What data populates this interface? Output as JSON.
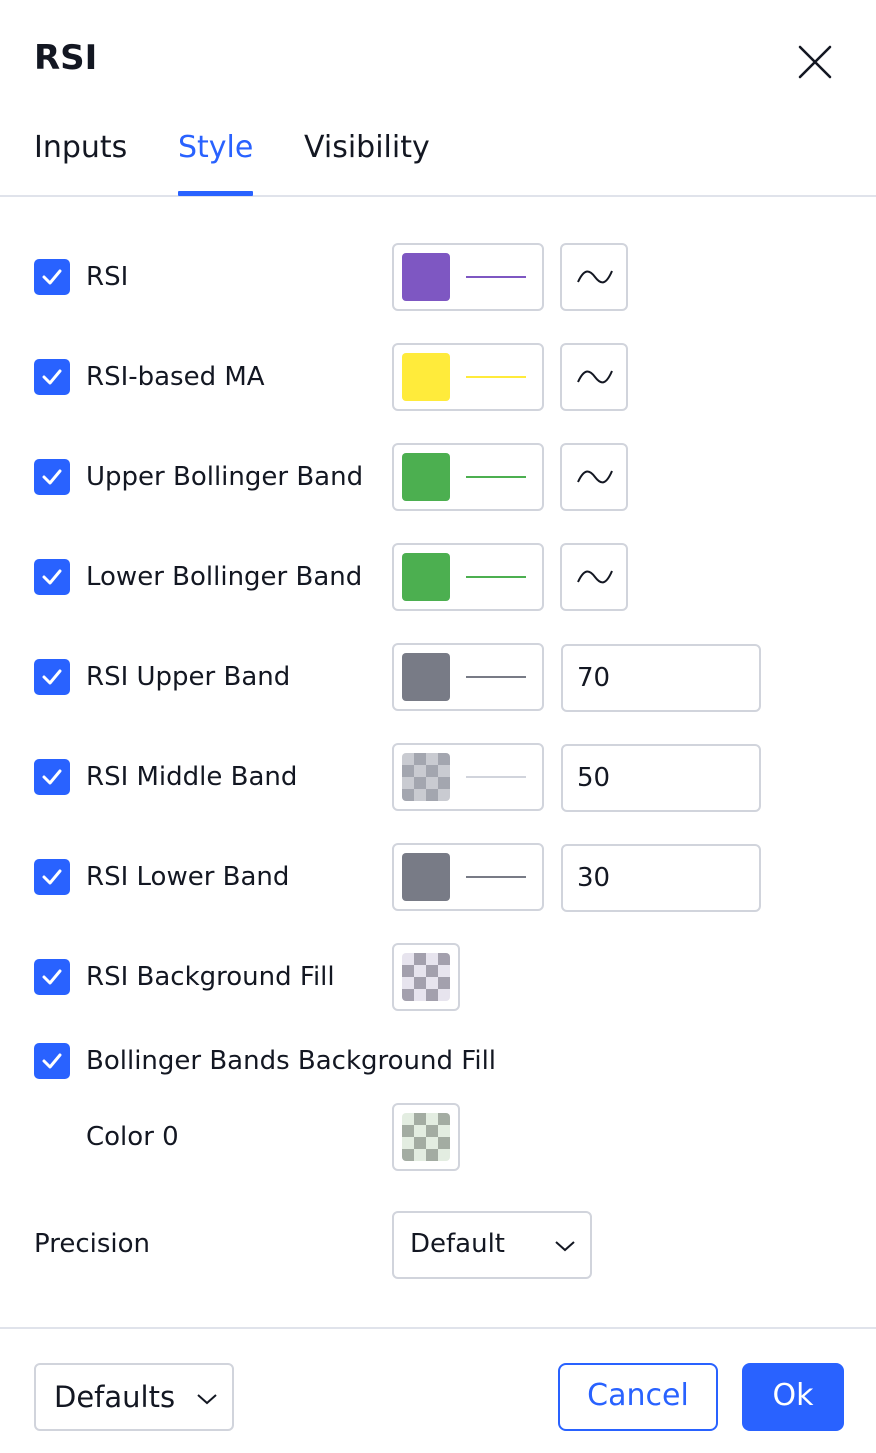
{
  "dialog": {
    "title": "RSI"
  },
  "tabs": [
    {
      "label": "Inputs",
      "active": false
    },
    {
      "label": "Style",
      "active": true
    },
    {
      "label": "Visibility",
      "active": false
    }
  ],
  "rows": [
    {
      "label": "RSI",
      "checked": true,
      "color": "#7e57c2"
    },
    {
      "label": "RSI-based MA",
      "checked": true,
      "color": "#ffeb3b"
    },
    {
      "label": "Upper Bollinger Band",
      "checked": true,
      "color": "#4caf50"
    },
    {
      "label": "Lower Bollinger Band",
      "checked": true,
      "color": "#4caf50"
    },
    {
      "label": "RSI Upper Band",
      "checked": true,
      "color": "#787b86",
      "value": "70"
    },
    {
      "label": "RSI Middle Band",
      "checked": true,
      "color": "#787b86",
      "value": "50"
    },
    {
      "label": "RSI Lower Band",
      "checked": true,
      "color": "#787b86",
      "value": "30"
    },
    {
      "label": "RSI Background Fill",
      "checked": true,
      "color": "#7e57c2"
    },
    {
      "label": "Bollinger Bands Background Fill",
      "checked": true
    }
  ],
  "color0": {
    "label": "Color 0",
    "color": "#4caf50"
  },
  "precision": {
    "label": "Precision",
    "value": "Default"
  },
  "footer": {
    "defaults_label": "Defaults",
    "cancel_label": "Cancel",
    "ok_label": "Ok"
  },
  "colors": {
    "accent": "#2962ff",
    "border": "#d1d4dc",
    "text": "#131722"
  }
}
